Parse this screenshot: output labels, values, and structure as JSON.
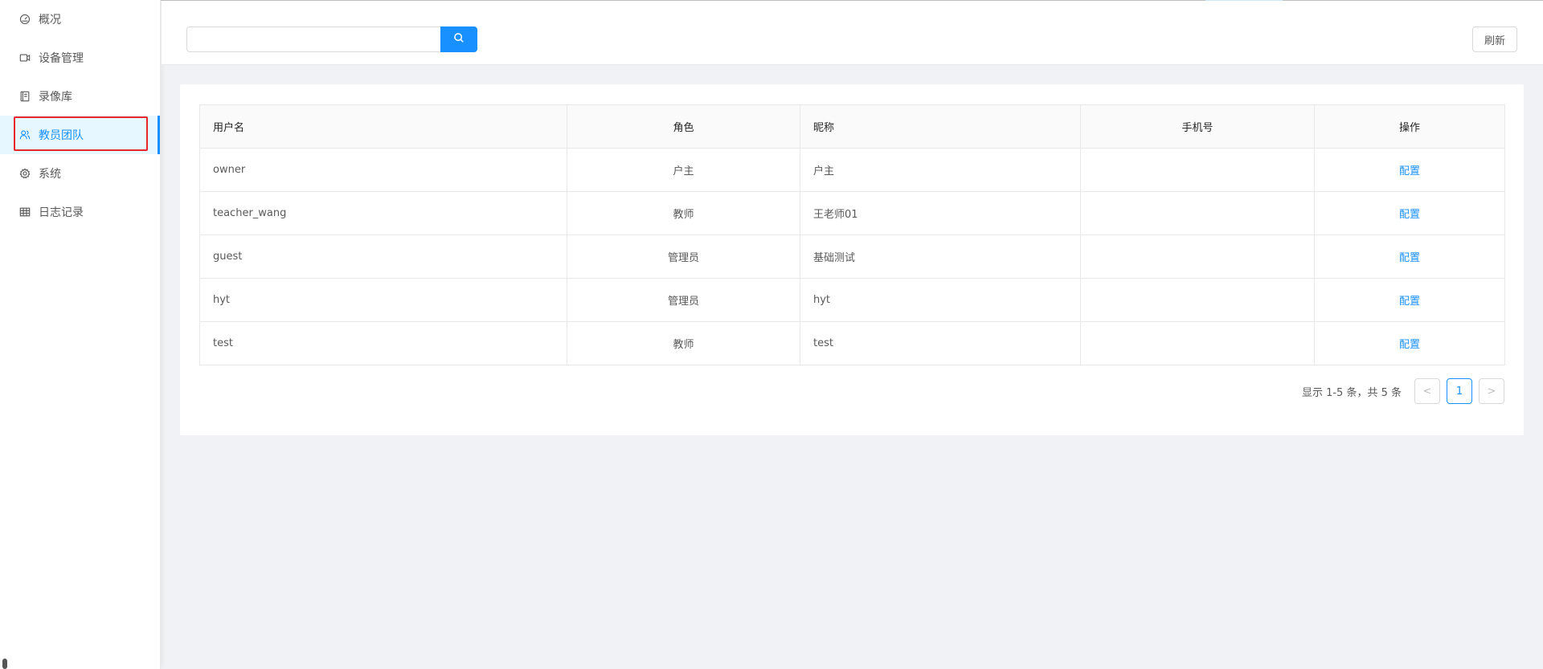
{
  "sidebar": {
    "items": [
      {
        "label": "概况",
        "icon": "dashboard-icon"
      },
      {
        "label": "设备管理",
        "icon": "video-camera-icon"
      },
      {
        "label": "录像库",
        "icon": "book-icon"
      },
      {
        "label": "教员团队",
        "icon": "team-icon",
        "active": true
      },
      {
        "label": "系统",
        "icon": "gear-icon"
      },
      {
        "label": "日志记录",
        "icon": "table-icon"
      }
    ]
  },
  "header": {
    "search": {
      "value": "",
      "placeholder": ""
    },
    "refresh_label": "刷新"
  },
  "table": {
    "columns": [
      "用户名",
      "角色",
      "昵称",
      "手机号",
      "操作"
    ],
    "rows": [
      {
        "username": "owner",
        "role": "户主",
        "nickname": "户主",
        "phone": "",
        "action": "配置"
      },
      {
        "username": "teacher_wang",
        "role": "教师",
        "nickname": "王老师01",
        "phone": "",
        "action": "配置"
      },
      {
        "username": "guest",
        "role": "管理员",
        "nickname": "基础测试",
        "phone": "",
        "action": "配置"
      },
      {
        "username": "hyt",
        "role": "管理员",
        "nickname": "hyt",
        "phone": "",
        "action": "配置"
      },
      {
        "username": "test",
        "role": "教师",
        "nickname": "test",
        "phone": "",
        "action": "配置"
      }
    ]
  },
  "pagination": {
    "total_text": "显示 1-5 条，共 5 条",
    "current_page": "1",
    "prev_symbol": "<",
    "next_symbol": ">"
  },
  "colors": {
    "accent": "#1890ff",
    "highlight": "#e8262b"
  }
}
